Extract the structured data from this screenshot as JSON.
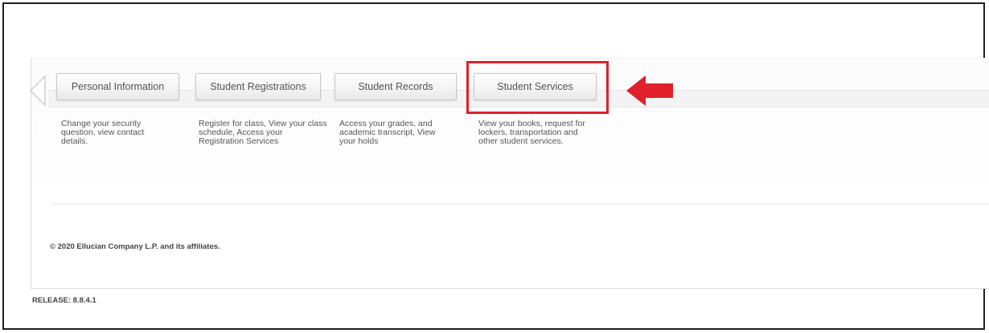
{
  "tabs": [
    {
      "label": "Personal Information",
      "description": "Change your security question, view contact details."
    },
    {
      "label": "Student Registrations",
      "description": "Register for class, View your class schedule, Access your Registration Services"
    },
    {
      "label": "Student Records",
      "description": "Access your grades, and academic transcript, View your holds"
    },
    {
      "label": "Student Services",
      "description": "View your books, request for lockers, transportation and other student services."
    }
  ],
  "highlighted_tab": "Student Services",
  "annotation": {
    "highlight_color": "#e0202a",
    "arrow_icon": "arrow-left-icon"
  },
  "footer": {
    "copyright": "© 2020 Ellucian Company L.P. and its affiliates.",
    "release": "RELEASE: 8.8.4.1"
  }
}
